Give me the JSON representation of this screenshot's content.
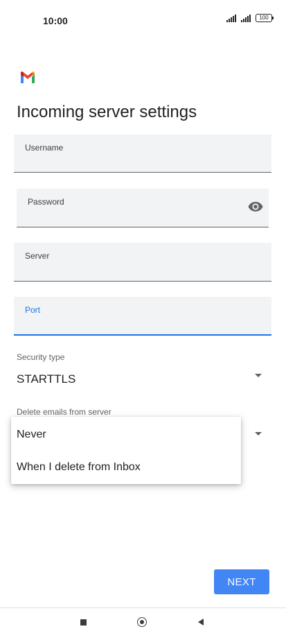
{
  "status_bar": {
    "time": "10:00",
    "battery": "100"
  },
  "page": {
    "title": "Incoming server settings"
  },
  "fields": {
    "username": {
      "label": "Username",
      "value": ""
    },
    "password": {
      "label": "Password",
      "value": ""
    },
    "server": {
      "label": "Server",
      "value": ""
    },
    "port": {
      "label": "Port",
      "value": ""
    }
  },
  "security": {
    "label": "Security type",
    "value": "STARTTLS"
  },
  "delete_emails": {
    "label": "Delete emails from server",
    "options": [
      "Never",
      "When I delete from Inbox"
    ]
  },
  "buttons": {
    "next": "NEXT"
  },
  "colors": {
    "accent": "#1a73e8",
    "button": "#4285f4",
    "field_bg": "#f1f3f4"
  }
}
